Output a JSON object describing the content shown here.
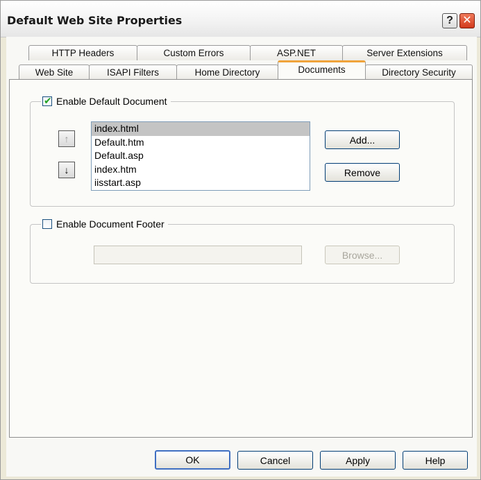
{
  "window": {
    "title": "Default Web Site Properties"
  },
  "titlebar_buttons": {
    "help": "?",
    "close": "✕"
  },
  "tabs_row1": [
    "HTTP Headers",
    "Custom Errors",
    "ASP.NET",
    "Server Extensions"
  ],
  "tabs_row2": [
    "Web Site",
    "ISAPI Filters",
    "Home Directory",
    "Documents",
    "Directory Security"
  ],
  "active_tab": "Documents",
  "default_document": {
    "label": "Enable Default Document",
    "checked": true,
    "documents": [
      "index.html",
      "Default.htm",
      "Default.asp",
      "index.htm",
      "iisstart.asp"
    ],
    "selected": "index.html",
    "move_up_icon": "arrow-up-icon",
    "move_down_icon": "arrow-down-icon",
    "add_label": "Add...",
    "remove_label": "Remove"
  },
  "document_footer": {
    "label": "Enable Document Footer",
    "checked": false,
    "path_value": "",
    "browse_label": "Browse..."
  },
  "footer_buttons": {
    "ok": "OK",
    "cancel": "Cancel",
    "apply": "Apply",
    "help": "Help"
  },
  "colors": {
    "active_tab_accent": "#f0a33a",
    "close_button": "#d2381c",
    "checkmark": "#21a121"
  }
}
